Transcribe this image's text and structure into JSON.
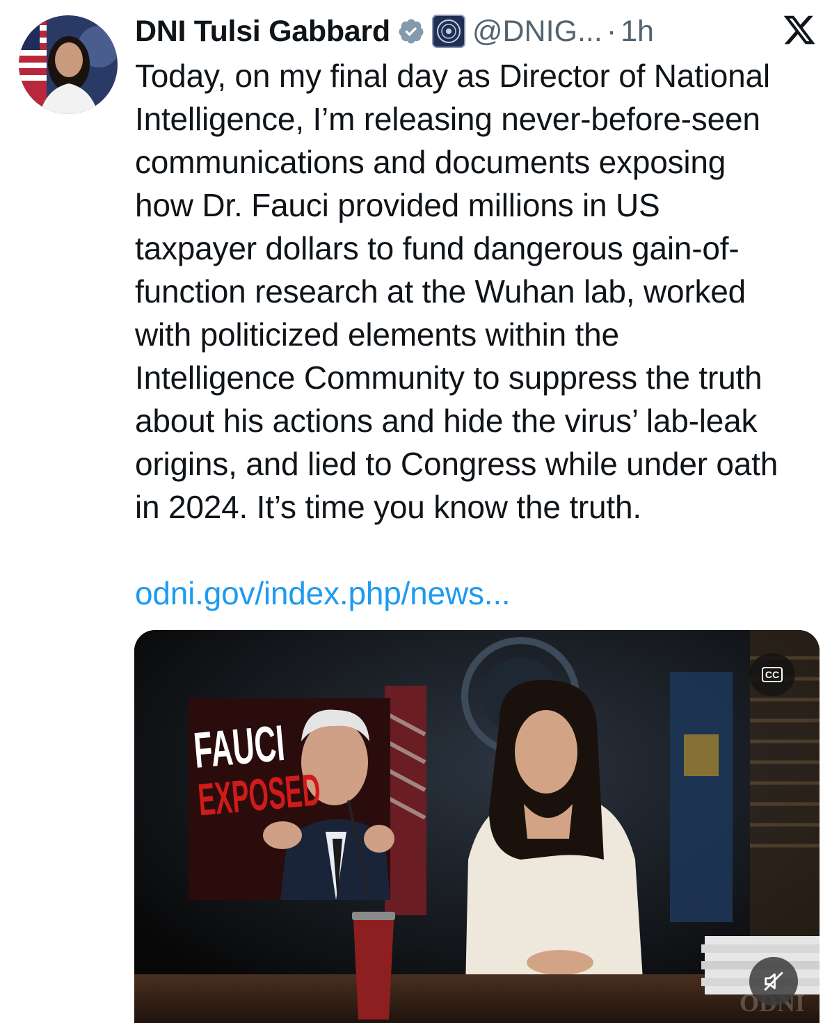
{
  "tweet": {
    "display_name": "DNI Tulsi Gabbard",
    "handle": "@DNIG...",
    "separator": "·",
    "time": "1h",
    "body_lines": [
      "Today, on my final day as Director of National",
      "Intelligence, I’m releasing never-before-seen",
      "communications and documents exposing",
      "how Dr. Fauci provided millions in US",
      "taxpayer dollars to fund dangerous gain-of-",
      "function research at the Wuhan lab, worked",
      "with politicized elements within the",
      "Intelligence Community to suppress the truth",
      "about his actions and hide the virus’ lab-leak",
      "origins, and lied to Congress while under oath",
      "in 2024. It’s time you know the truth."
    ],
    "link_text": "odni.gov/index.php/news..."
  },
  "media": {
    "inset_title_line1": "FAUCI",
    "inset_title_line2": "EXPOSED",
    "cc_label": "CC",
    "watermark": "ODNI"
  },
  "icons": {
    "verified": "verified-badge-icon",
    "affiliation": "agency-seal-icon",
    "logo": "x-logo-icon",
    "captions": "closed-captions-icon",
    "mute": "muted-speaker-icon"
  },
  "colors": {
    "link": "#1d9bf0",
    "secondary_text": "#536471",
    "verified_badge": "#829aab",
    "inset_red": "#d11a1a"
  }
}
